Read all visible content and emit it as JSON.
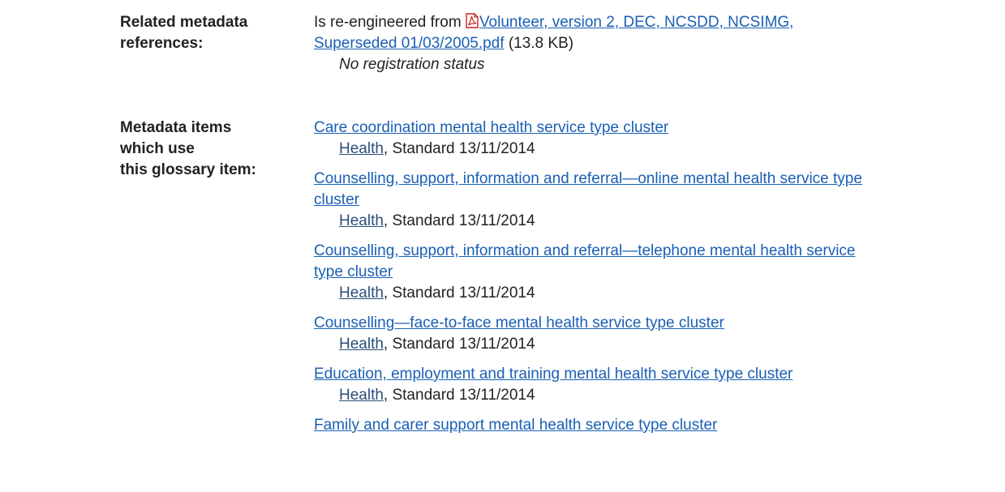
{
  "related": {
    "label_line1": "Related metadata",
    "label_line2": "references:",
    "prefix": "Is re-engineered from",
    "link_line1": "Volunteer, version 2, DEC, NCSDD, NCSIMG,",
    "link_line2": "Superseded 01/03/2005.pdf",
    "size": "(13.8 KB)",
    "status": "No registration status",
    "icon": "pdf-icon"
  },
  "usage": {
    "label_line1": "Metadata items which use",
    "label_line2": "this glossary item:",
    "items": [
      {
        "title_line1": "Care coordination mental health service type cluster",
        "title_line2": "",
        "org": "Health",
        "status": ", Standard 13/11/2014"
      },
      {
        "title_line1": "Counselling, support, information and referral—online mental health service type",
        "title_line2": "cluster",
        "org": "Health",
        "status": ", Standard 13/11/2014"
      },
      {
        "title_line1": "Counselling, support, information and referral—telephone mental health service",
        "title_line2": "type cluster",
        "org": "Health",
        "status": ", Standard 13/11/2014"
      },
      {
        "title_line1": "Counselling—face-to-face mental health service type cluster",
        "title_line2": "",
        "org": "Health",
        "status": ", Standard 13/11/2014"
      },
      {
        "title_line1": "Education, employment and training mental health service type cluster",
        "title_line2": "",
        "org": "Health",
        "status": ", Standard 13/11/2014"
      },
      {
        "title_line1": "Family and carer support mental health service type cluster",
        "title_line2": "",
        "org": "",
        "status": ""
      }
    ]
  },
  "colors": {
    "link": "#1a5fb4",
    "text": "#222222",
    "pdf_icon": "#cc2222"
  }
}
